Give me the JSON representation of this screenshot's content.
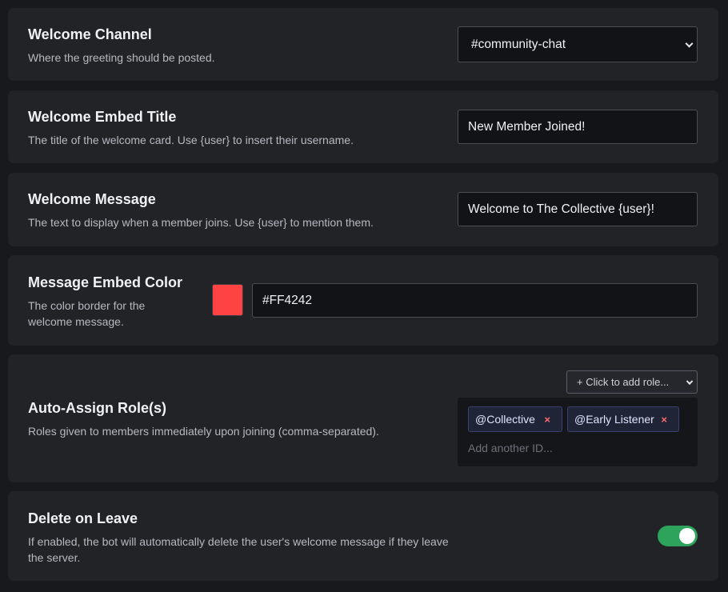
{
  "welcome_channel": {
    "title": "Welcome Channel",
    "description": "Where the greeting should be posted.",
    "selected": "#community-chat"
  },
  "embed_title": {
    "title": "Welcome Embed Title",
    "description": "The title of the welcome card. Use {user} to insert their username.",
    "value": "New Member Joined!"
  },
  "welcome_message": {
    "title": "Welcome Message",
    "description": "The text to display when a member joins. Use {user} to mention them.",
    "value": "Welcome to The Collective {user}!"
  },
  "embed_color": {
    "title": "Message Embed Color",
    "description_line1": "The color border for the",
    "description_line2": "welcome message.",
    "value": "#FF4242",
    "swatch_color": "#ff4242"
  },
  "auto_roles": {
    "title": "Auto-Assign Role(s)",
    "description": "Roles given to members immediately upon joining (comma-separated).",
    "add_role_label": "+ Click to add role...",
    "roles": [
      {
        "label": "@Collective",
        "remove": "×"
      },
      {
        "label": "@Early Listener",
        "remove": "×"
      }
    ],
    "input_placeholder": "Add another ID..."
  },
  "delete_on_leave": {
    "title": "Delete on Leave",
    "description_line1": "If enabled, the bot will automatically delete the user's welcome message if they leave",
    "description_line2": "the server.",
    "enabled": true,
    "accent_color": "#2ea35b"
  }
}
